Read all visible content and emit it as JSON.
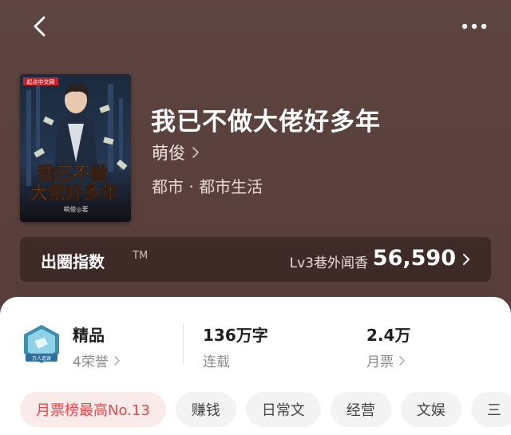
{
  "book": {
    "title": "我已不做大佬好多年",
    "author": "萌俊",
    "category": "都市 · 都市生活",
    "cover": {
      "title_line1": "我已不做",
      "title_line2": "大佬好多年",
      "author_tag": "萌俊◎著",
      "publisher": "起点中文网"
    }
  },
  "popularity": {
    "label": "出圈指数",
    "tm": "TM",
    "level": "Lv3巷外闻香",
    "value": "56,590"
  },
  "stats": {
    "honor": {
      "title": "精品",
      "sub": "4荣誉",
      "badge_text": "万人追读"
    },
    "words": {
      "title": "136万字",
      "sub": "连载"
    },
    "tickets": {
      "title": "2.4万",
      "sub": "月票"
    }
  },
  "tags": [
    "月票榜最高No.13",
    "赚钱",
    "日常文",
    "经营",
    "文娱",
    "三"
  ],
  "colors": {
    "background": "#5a403c",
    "tag_hot_text": "#e04b4b",
    "tag_hot_bg": "#fbeaea",
    "panel": "#ffffff"
  },
  "icons": {
    "back": "chevron-left-icon",
    "more": "more-dots-icon",
    "chevron": "chevron-right-icon",
    "badge": "honor-badge-icon"
  }
}
